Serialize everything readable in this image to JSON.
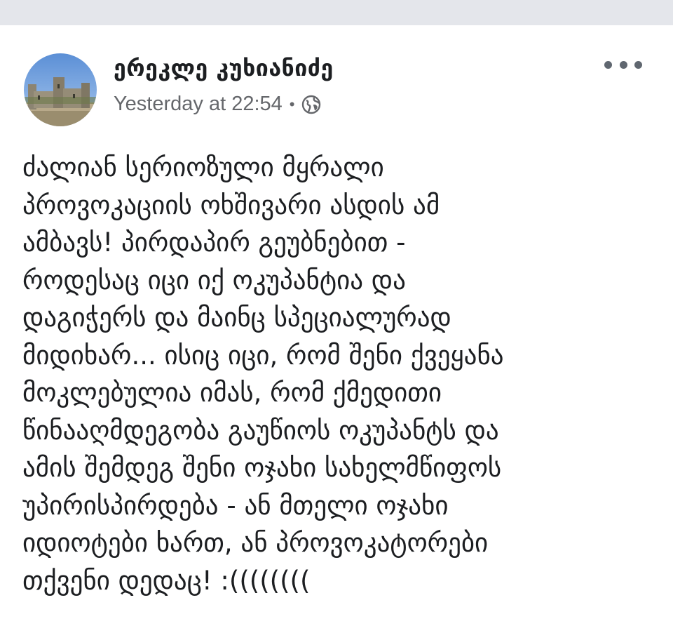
{
  "post": {
    "author_name": "ერეკლე კუხიანიძე",
    "timestamp": "Yesterday at 22:54",
    "separator": "•",
    "privacy_icon": "globe-icon",
    "more_icon": "more-options-icon",
    "body_lines": [
      "ძალიან სერიოზული მყრალი",
      "პროვოკაციის ოხშივარი ასდის ამ",
      "ამბავს! პირდაპირ გეუბნებით -",
      "როდესაც იცი იქ ოკუპანტია და",
      "დაგიჭერს და მაინც სპეციალურად",
      "მიდიხარ... ისიც იცი, რომ შენი ქვეყანა",
      "მოკლებულია იმას, რომ ქმედითი",
      "წინააღმდეგობა გაუწიოს ოკუპანტს და",
      "ამის შემდეგ შენი ოჯახი სახელმწიფოს",
      "უპირისპირდება - ან მთელი ოჯახი",
      "იდიოტები ხართ, ან პროვოკატორები",
      "თქვენი დედაც! :(((((((("
    ]
  },
  "colors": {
    "top_bar": "#e4e6eb",
    "text_primary": "#1c1e21",
    "text_secondary": "#65676b",
    "icon_gray": "#606770"
  }
}
